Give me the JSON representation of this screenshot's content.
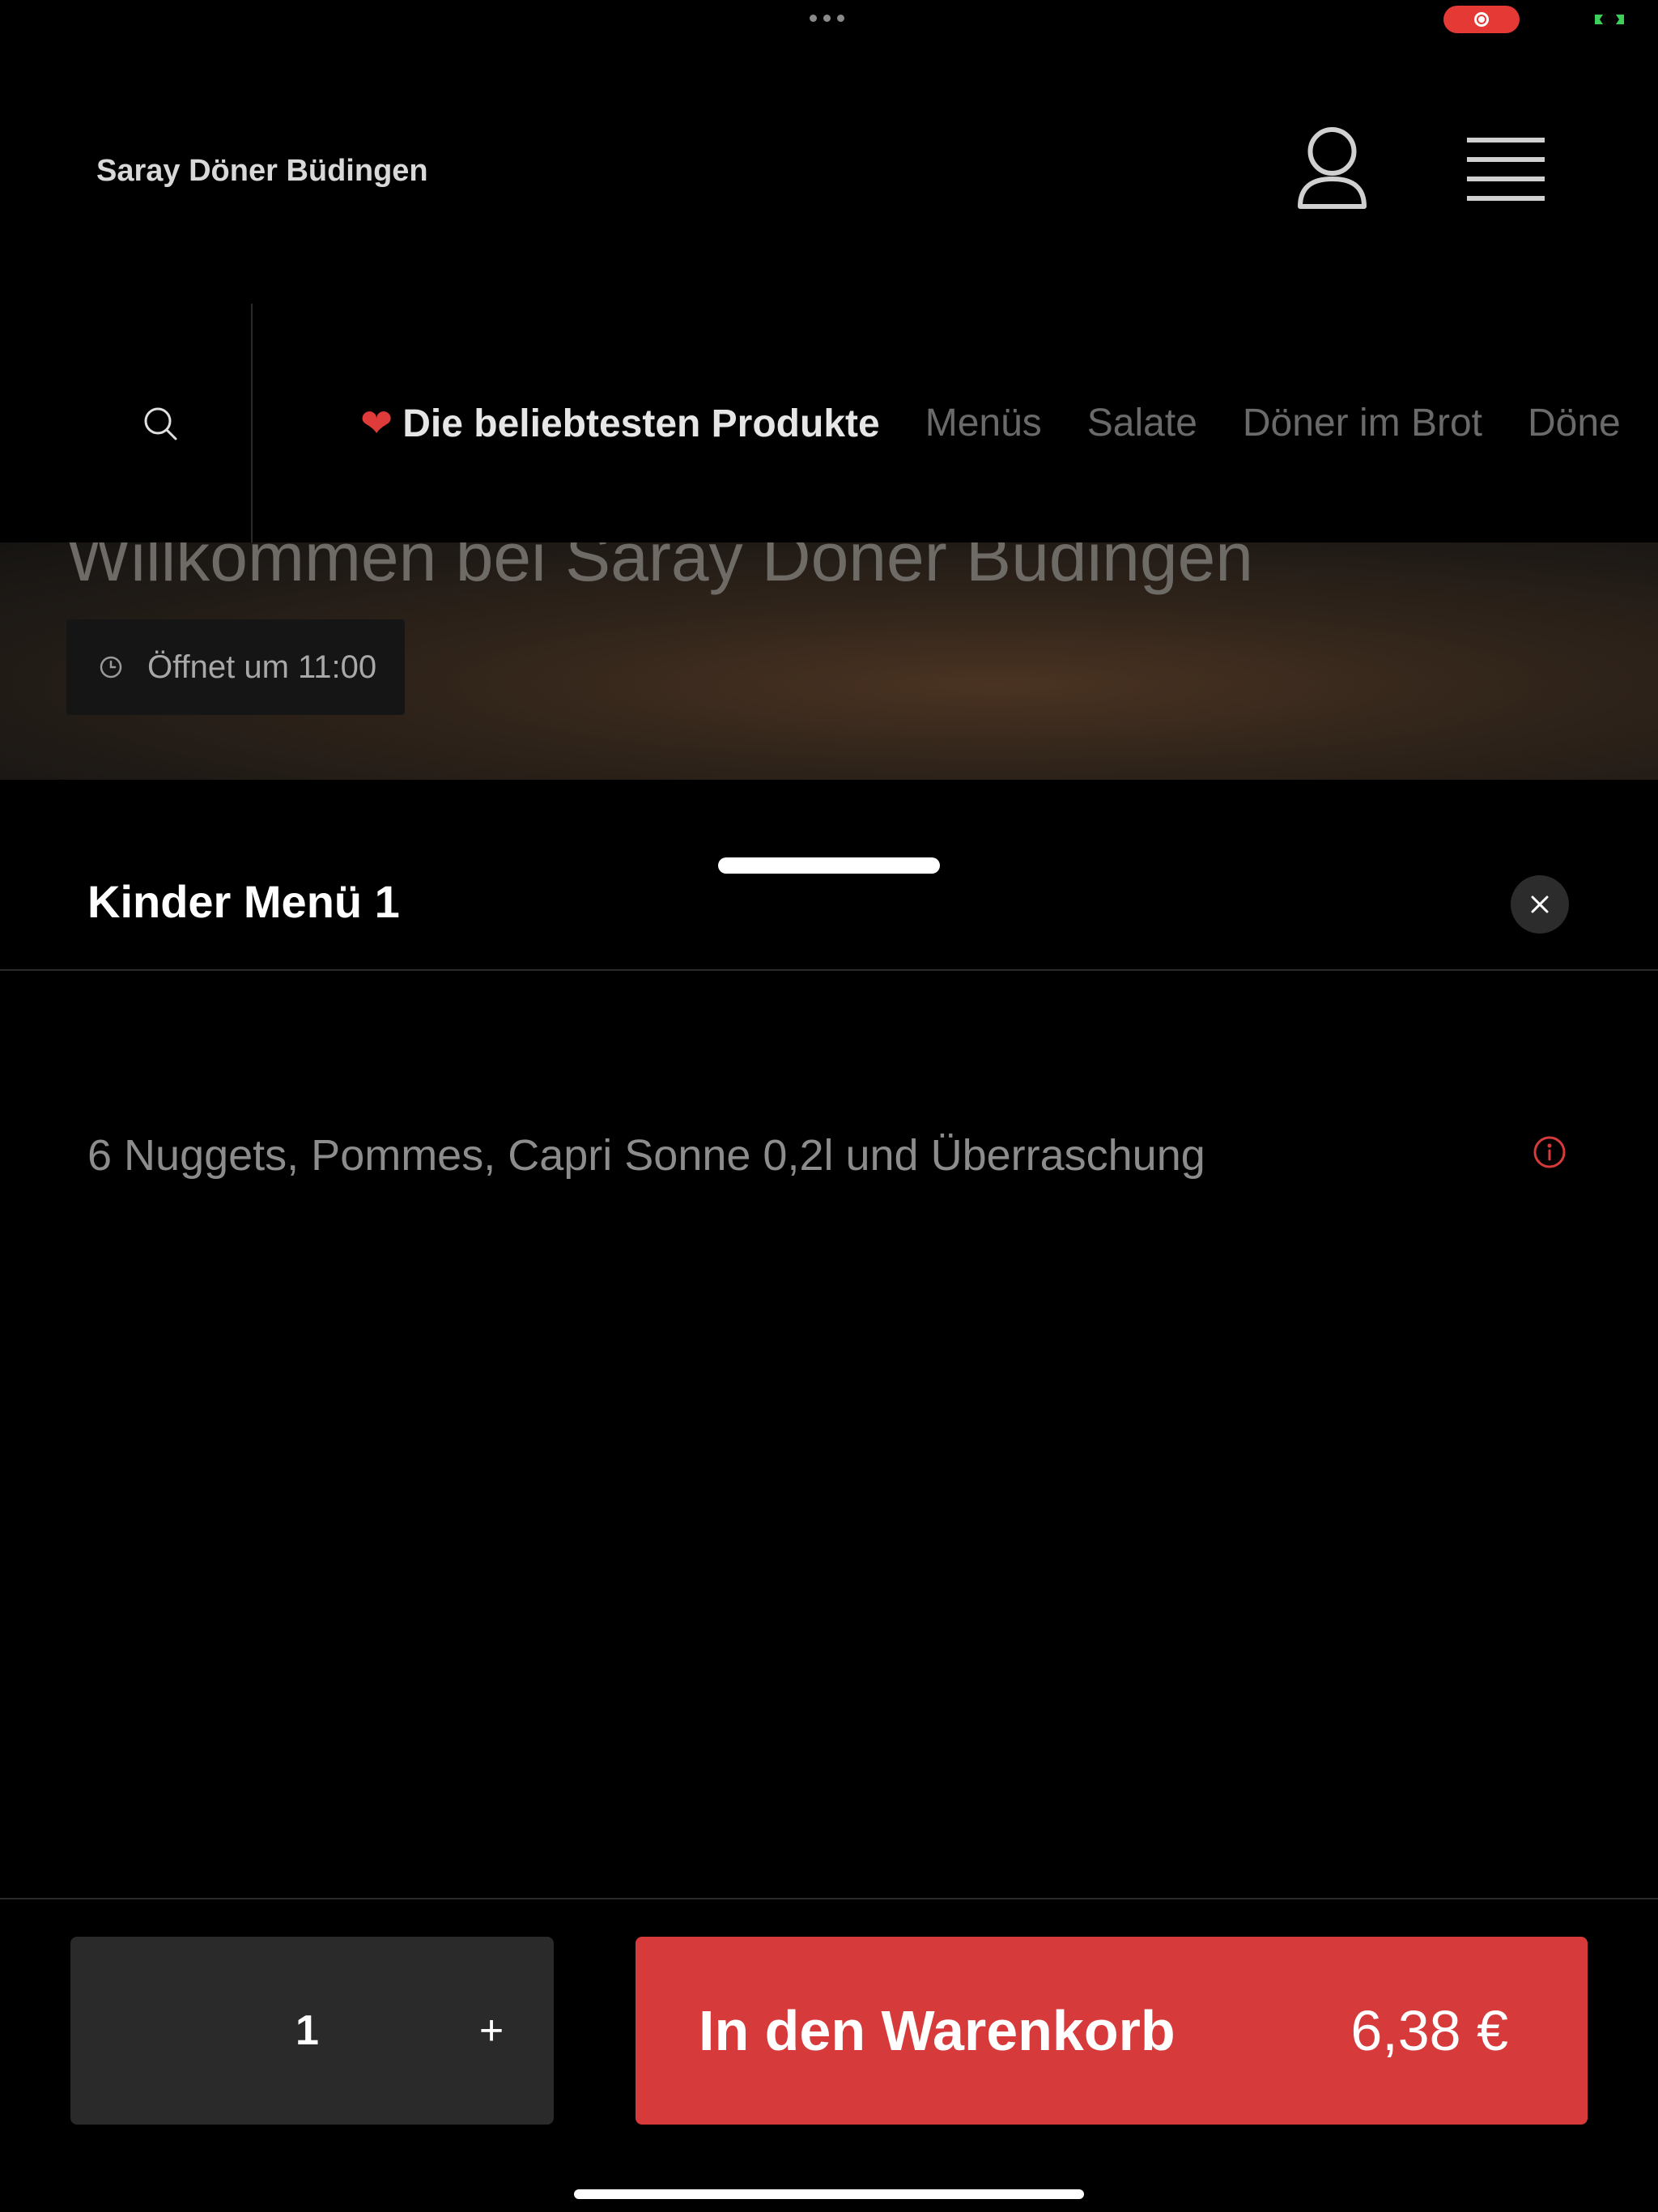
{
  "header": {
    "site_title": "Saray Döner Büdingen",
    "account_icon": "person-icon",
    "menu_icon": "hamburger-icon"
  },
  "nav": {
    "search_icon": "search-icon",
    "heart": "❤",
    "tabs": [
      {
        "label": "Die beliebtesten Produkte",
        "active": true
      },
      {
        "label": "Menüs"
      },
      {
        "label": "Salate"
      },
      {
        "label": "Döner im Brot"
      },
      {
        "label": "Döne"
      }
    ]
  },
  "hero": {
    "title": "Willkommen bei Saray Döner Büdingen",
    "open_status": "Öffnet um 11:00"
  },
  "product": {
    "title": "Kinder Menü 1",
    "description": "6 Nuggets, Pommes, Capri Sonne 0,2l und Überraschung",
    "quantity": "1",
    "plus_symbol": "+",
    "add_to_cart_label": "In den Warenkorb",
    "price": "6,38 €"
  },
  "colors": {
    "accent": "#d63a3a",
    "background": "#000000",
    "info_icon": "#d63a3a"
  }
}
